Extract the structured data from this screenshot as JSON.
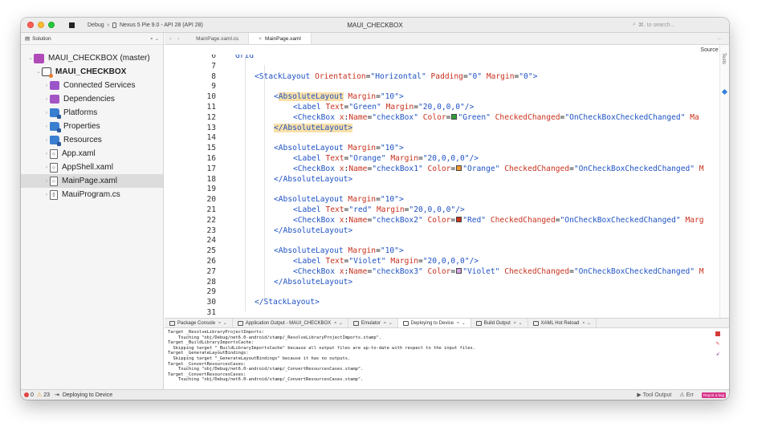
{
  "titlebar": {
    "config": "Debug",
    "separator": "›",
    "device": "Nexus 5 Pie 9.0 - API 28 (API 28)",
    "title": "MAUI_CHECKBOX",
    "search_placeholder": "⌘. to search..."
  },
  "sidebar": {
    "header": "Solution",
    "header_right": "⚬ ⌄",
    "items": [
      {
        "label": "MAUI_CHECKBOX (master)",
        "icon": "solution-icon",
        "indent": 0
      },
      {
        "label": "MAUI_CHECKBOX",
        "icon": "project-icon",
        "indent": 1,
        "bold": true
      },
      {
        "label": "Connected Services",
        "icon": "connected-services-icon",
        "indent": 2
      },
      {
        "label": "Dependencies",
        "icon": "dependencies-icon",
        "indent": 2
      },
      {
        "label": "Platforms",
        "icon": "folder-icon",
        "indent": 2
      },
      {
        "label": "Properties",
        "icon": "folder-icon",
        "indent": 2
      },
      {
        "label": "Resources",
        "icon": "folder-icon",
        "indent": 2
      },
      {
        "label": "App.xaml",
        "icon": "xaml-file-icon",
        "indent": 2
      },
      {
        "label": "AppShell.xaml",
        "icon": "xaml-file-icon",
        "indent": 2
      },
      {
        "label": "MainPage.xaml",
        "icon": "xaml-file-icon",
        "indent": 2,
        "selected": true
      },
      {
        "label": "MauiProgram.cs",
        "icon": "cs-file-icon",
        "indent": 2
      }
    ]
  },
  "editor": {
    "tabs": [
      {
        "label": "MainPage.xaml.cs",
        "active": false
      },
      {
        "label": "MainPage.xaml",
        "active": true
      }
    ],
    "source_label": "Source ◊",
    "right_rail_label": "Tests",
    "lines": [
      {
        "n": "6",
        "indent": 0,
        "parts": [
          [
            "tag",
            "Grid"
          ]
        ]
      },
      {
        "n": "7",
        "indent": 0,
        "parts": []
      },
      {
        "n": "8",
        "indent": 1,
        "parts": [
          [
            "tag",
            "<StackLayout "
          ],
          [
            "attr",
            "Orientation"
          ],
          [
            "text",
            "="
          ],
          [
            "val",
            "\"Horizontal\" "
          ],
          [
            "attr",
            "Padding"
          ],
          [
            "text",
            "="
          ],
          [
            "val",
            "\"0\" "
          ],
          [
            "attr",
            "Margin"
          ],
          [
            "text",
            "="
          ],
          [
            "val",
            "\"0\""
          ],
          [
            "tag",
            ">"
          ]
        ]
      },
      {
        "n": "9",
        "indent": 0,
        "parts": []
      },
      {
        "n": "10",
        "indent": 2,
        "parts": [
          [
            "tag",
            "<"
          ],
          [
            "hltag",
            "AbsoluteLayout"
          ],
          [
            "attr",
            " Margin"
          ],
          [
            "text",
            "="
          ],
          [
            "val",
            "\"10\""
          ],
          [
            "tag",
            ">"
          ]
        ]
      },
      {
        "n": "11",
        "indent": 3,
        "parts": [
          [
            "tag",
            "<Label "
          ],
          [
            "attr",
            "Text"
          ],
          [
            "text",
            "="
          ],
          [
            "val",
            "\"Green\" "
          ],
          [
            "attr",
            "Margin"
          ],
          [
            "text",
            "="
          ],
          [
            "val",
            "\"20,0,0,0\""
          ],
          [
            "tag",
            "/>"
          ]
        ]
      },
      {
        "n": "12",
        "indent": 3,
        "parts": [
          [
            "tag",
            "<CheckBox "
          ],
          [
            "attr",
            "x"
          ],
          [
            "text",
            ":"
          ],
          [
            "attr",
            "Name"
          ],
          [
            "text",
            "="
          ],
          [
            "val",
            "\"checkBox\" "
          ],
          [
            "attr",
            "Color"
          ],
          [
            "text",
            "="
          ],
          [
            "swatch",
            "#2e9e3a"
          ],
          [
            "val",
            "\"Green\" "
          ],
          [
            "attr",
            "CheckedChanged"
          ],
          [
            "text",
            "="
          ],
          [
            "val",
            "\"OnCheckBoxCheckedChanged\" "
          ],
          [
            "attr",
            "Ma"
          ]
        ]
      },
      {
        "n": "13",
        "indent": 2,
        "parts": [
          [
            "hlclose",
            "</AbsoluteLayout>"
          ]
        ]
      },
      {
        "n": "14",
        "indent": 0,
        "parts": []
      },
      {
        "n": "15",
        "indent": 2,
        "parts": [
          [
            "tag",
            "<AbsoluteLayout "
          ],
          [
            "attr",
            "Margin"
          ],
          [
            "text",
            "="
          ],
          [
            "val",
            "\"10\""
          ],
          [
            "tag",
            ">"
          ]
        ]
      },
      {
        "n": "16",
        "indent": 3,
        "parts": [
          [
            "tag",
            "<Label "
          ],
          [
            "attr",
            "Text"
          ],
          [
            "text",
            "="
          ],
          [
            "val",
            "\"Orange\" "
          ],
          [
            "attr",
            "Margin"
          ],
          [
            "text",
            "="
          ],
          [
            "val",
            "\"20,0,0,0\""
          ],
          [
            "tag",
            "/>"
          ]
        ]
      },
      {
        "n": "17",
        "indent": 3,
        "parts": [
          [
            "tag",
            "<CheckBox "
          ],
          [
            "attr",
            "x"
          ],
          [
            "text",
            ":"
          ],
          [
            "attr",
            "Name"
          ],
          [
            "text",
            "="
          ],
          [
            "val",
            "\"checkBox1\" "
          ],
          [
            "attr",
            "Color"
          ],
          [
            "text",
            "="
          ],
          [
            "swatch",
            "#f29a2e"
          ],
          [
            "val",
            "\"Orange\" "
          ],
          [
            "attr",
            "CheckedChanged"
          ],
          [
            "text",
            "="
          ],
          [
            "val",
            "\"OnCheckBoxCheckedChanged\" "
          ],
          [
            "attr",
            "M"
          ]
        ]
      },
      {
        "n": "18",
        "indent": 2,
        "parts": [
          [
            "tag",
            "</AbsoluteLayout>"
          ]
        ]
      },
      {
        "n": "19",
        "indent": 0,
        "parts": []
      },
      {
        "n": "20",
        "indent": 2,
        "parts": [
          [
            "tag",
            "<AbsoluteLayout "
          ],
          [
            "attr",
            "Margin"
          ],
          [
            "text",
            "="
          ],
          [
            "val",
            "\"10\""
          ],
          [
            "tag",
            ">"
          ]
        ]
      },
      {
        "n": "21",
        "indent": 3,
        "parts": [
          [
            "tag",
            "<Label "
          ],
          [
            "attr",
            "Text"
          ],
          [
            "text",
            "="
          ],
          [
            "val",
            "\"red\" "
          ],
          [
            "attr",
            "Margin"
          ],
          [
            "text",
            "="
          ],
          [
            "val",
            "\"20,0,0,0\""
          ],
          [
            "tag",
            "/>"
          ]
        ]
      },
      {
        "n": "22",
        "indent": 3,
        "parts": [
          [
            "tag",
            "<CheckBox "
          ],
          [
            "attr",
            "x"
          ],
          [
            "text",
            ":"
          ],
          [
            "attr",
            "Name"
          ],
          [
            "text",
            "="
          ],
          [
            "val",
            "\"checkBox2\" "
          ],
          [
            "attr",
            "Color"
          ],
          [
            "text",
            "="
          ],
          [
            "swatch",
            "#c8311e"
          ],
          [
            "val",
            "\"Red\" "
          ],
          [
            "attr",
            "CheckedChanged"
          ],
          [
            "text",
            "="
          ],
          [
            "val",
            "\"OnCheckBoxCheckedChanged\" "
          ],
          [
            "attr",
            "Marg"
          ]
        ]
      },
      {
        "n": "23",
        "indent": 2,
        "parts": [
          [
            "tag",
            "</AbsoluteLayout>"
          ]
        ]
      },
      {
        "n": "24",
        "indent": 0,
        "parts": []
      },
      {
        "n": "25",
        "indent": 2,
        "parts": [
          [
            "tag",
            "<AbsoluteLayout "
          ],
          [
            "attr",
            "Margin"
          ],
          [
            "text",
            "="
          ],
          [
            "val",
            "\"10\""
          ],
          [
            "tag",
            ">"
          ]
        ]
      },
      {
        "n": "26",
        "indent": 3,
        "parts": [
          [
            "tag",
            "<Label "
          ],
          [
            "attr",
            "Text"
          ],
          [
            "text",
            "="
          ],
          [
            "val",
            "\"Violet\" "
          ],
          [
            "attr",
            "Margin"
          ],
          [
            "text",
            "="
          ],
          [
            "val",
            "\"20,0,0,0\""
          ],
          [
            "tag",
            "/>"
          ]
        ]
      },
      {
        "n": "27",
        "indent": 3,
        "parts": [
          [
            "tag",
            "<CheckBox "
          ],
          [
            "attr",
            "x"
          ],
          [
            "text",
            ":"
          ],
          [
            "attr",
            "Name"
          ],
          [
            "text",
            "="
          ],
          [
            "val",
            "\"checkBox3\" "
          ],
          [
            "attr",
            "Color"
          ],
          [
            "text",
            "="
          ],
          [
            "swatch",
            "#d7a3e3"
          ],
          [
            "val",
            "\"Violet\" "
          ],
          [
            "attr",
            "CheckedChanged"
          ],
          [
            "text",
            "="
          ],
          [
            "val",
            "\"OnCheckBoxCheckedChanged\" "
          ],
          [
            "attr",
            "M"
          ]
        ]
      },
      {
        "n": "28",
        "indent": 2,
        "parts": [
          [
            "tag",
            "</AbsoluteLayout>"
          ]
        ]
      },
      {
        "n": "29",
        "indent": 0,
        "parts": []
      },
      {
        "n": "30",
        "indent": 1,
        "parts": [
          [
            "tag",
            "</StackLayout>"
          ]
        ]
      },
      {
        "n": "31",
        "indent": 0,
        "parts": []
      }
    ]
  },
  "pad": {
    "tabs": [
      {
        "label": "Package Console",
        "active": false
      },
      {
        "label": "Application Output - MAUI_CHECKBOX",
        "active": false
      },
      {
        "label": "Emulator",
        "active": false
      },
      {
        "label": "Deploying to Device",
        "active": true
      },
      {
        "label": "Build Output",
        "active": false
      },
      {
        "label": "XAML Hot Reload",
        "active": false
      }
    ],
    "output": "Target _ResolveLibraryProjectImports:\n    Touching \"obj/Debug/net6.0-android/stamp/_ResolveLibraryProjectImports.stamp\".\nTarget _BuildLibraryImportsCache:\n  Skipping target \"_BuildLibraryImportsCache\" because all output files are up-to-date with respect to the input files.\nTarget _GenerateLayoutBindings:\n  Skipping target \"_GenerateLayoutBindings\" because it has no outputs.\nTarget _ConvertResourcesCases:\n    Touching \"obj/Debug/net6.0-android/stamp/_ConvertResourcesCases.stamp\".\nTarget _ConvertResourcesCases:\n    Touching \"obj/Debug/net6.0-android/stamp/_ConvertResourcesCases.stamp\"."
  },
  "status": {
    "errors": "0",
    "warnings": "23",
    "activity": "Deploying to Device",
    "tool_output": "Tool Output",
    "errors_label": "Err",
    "feedback": "Report a bug"
  }
}
